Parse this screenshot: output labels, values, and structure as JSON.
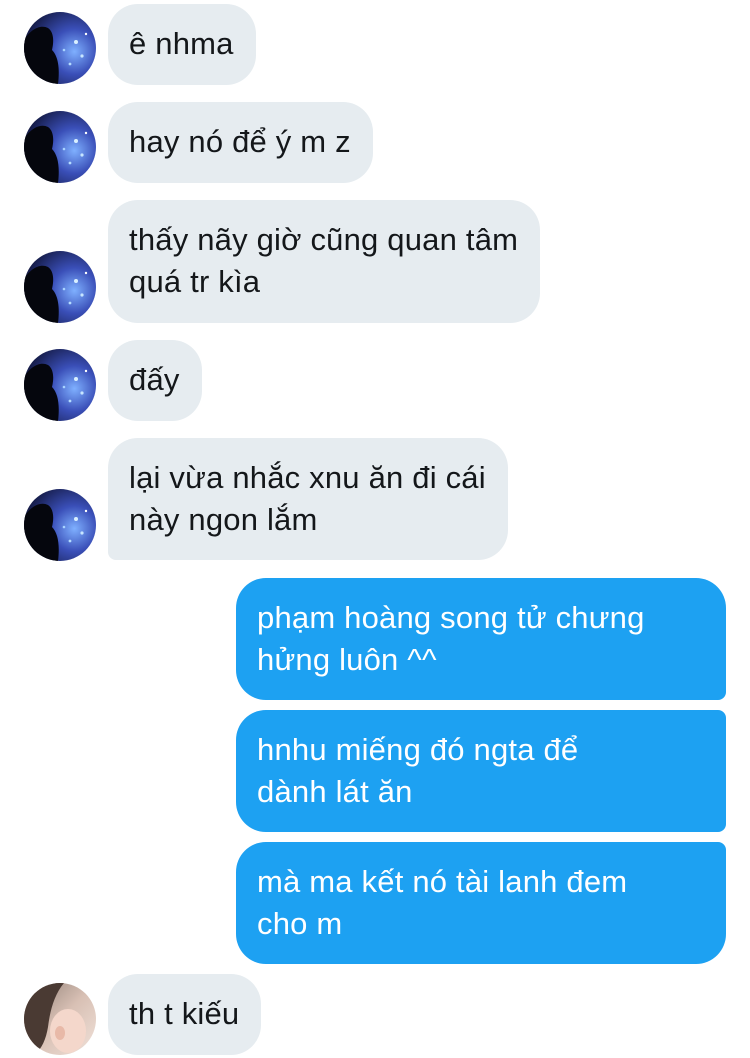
{
  "conversation": {
    "messages": [
      {
        "direction": "incoming",
        "text": "ê nhma"
      },
      {
        "direction": "incoming",
        "text": "hay nó để ý m z"
      },
      {
        "direction": "incoming",
        "text": "thấy nãy giờ cũng quan tâm\nquá tr kìa"
      },
      {
        "direction": "incoming",
        "text": "đấy"
      },
      {
        "direction": "incoming",
        "text": "lại vừa nhắc xnu ăn đi cái\nnày ngon lắm"
      },
      {
        "direction": "outgoing",
        "text": "phạm hoàng song tử chưng\nhửng luôn ^^"
      },
      {
        "direction": "outgoing",
        "text": "hnhu miếng đó ngta để\ndành lát ăn"
      },
      {
        "direction": "outgoing",
        "text": "mà ma kết nó tài lanh đem\ncho m"
      },
      {
        "direction": "incoming",
        "text": "th t kiếu"
      }
    ]
  },
  "colors": {
    "incoming_bubble": "#e6ecf0",
    "incoming_text": "#14171a",
    "outgoing_bubble": "#1da1f2",
    "outgoing_text": "#ffffff"
  }
}
